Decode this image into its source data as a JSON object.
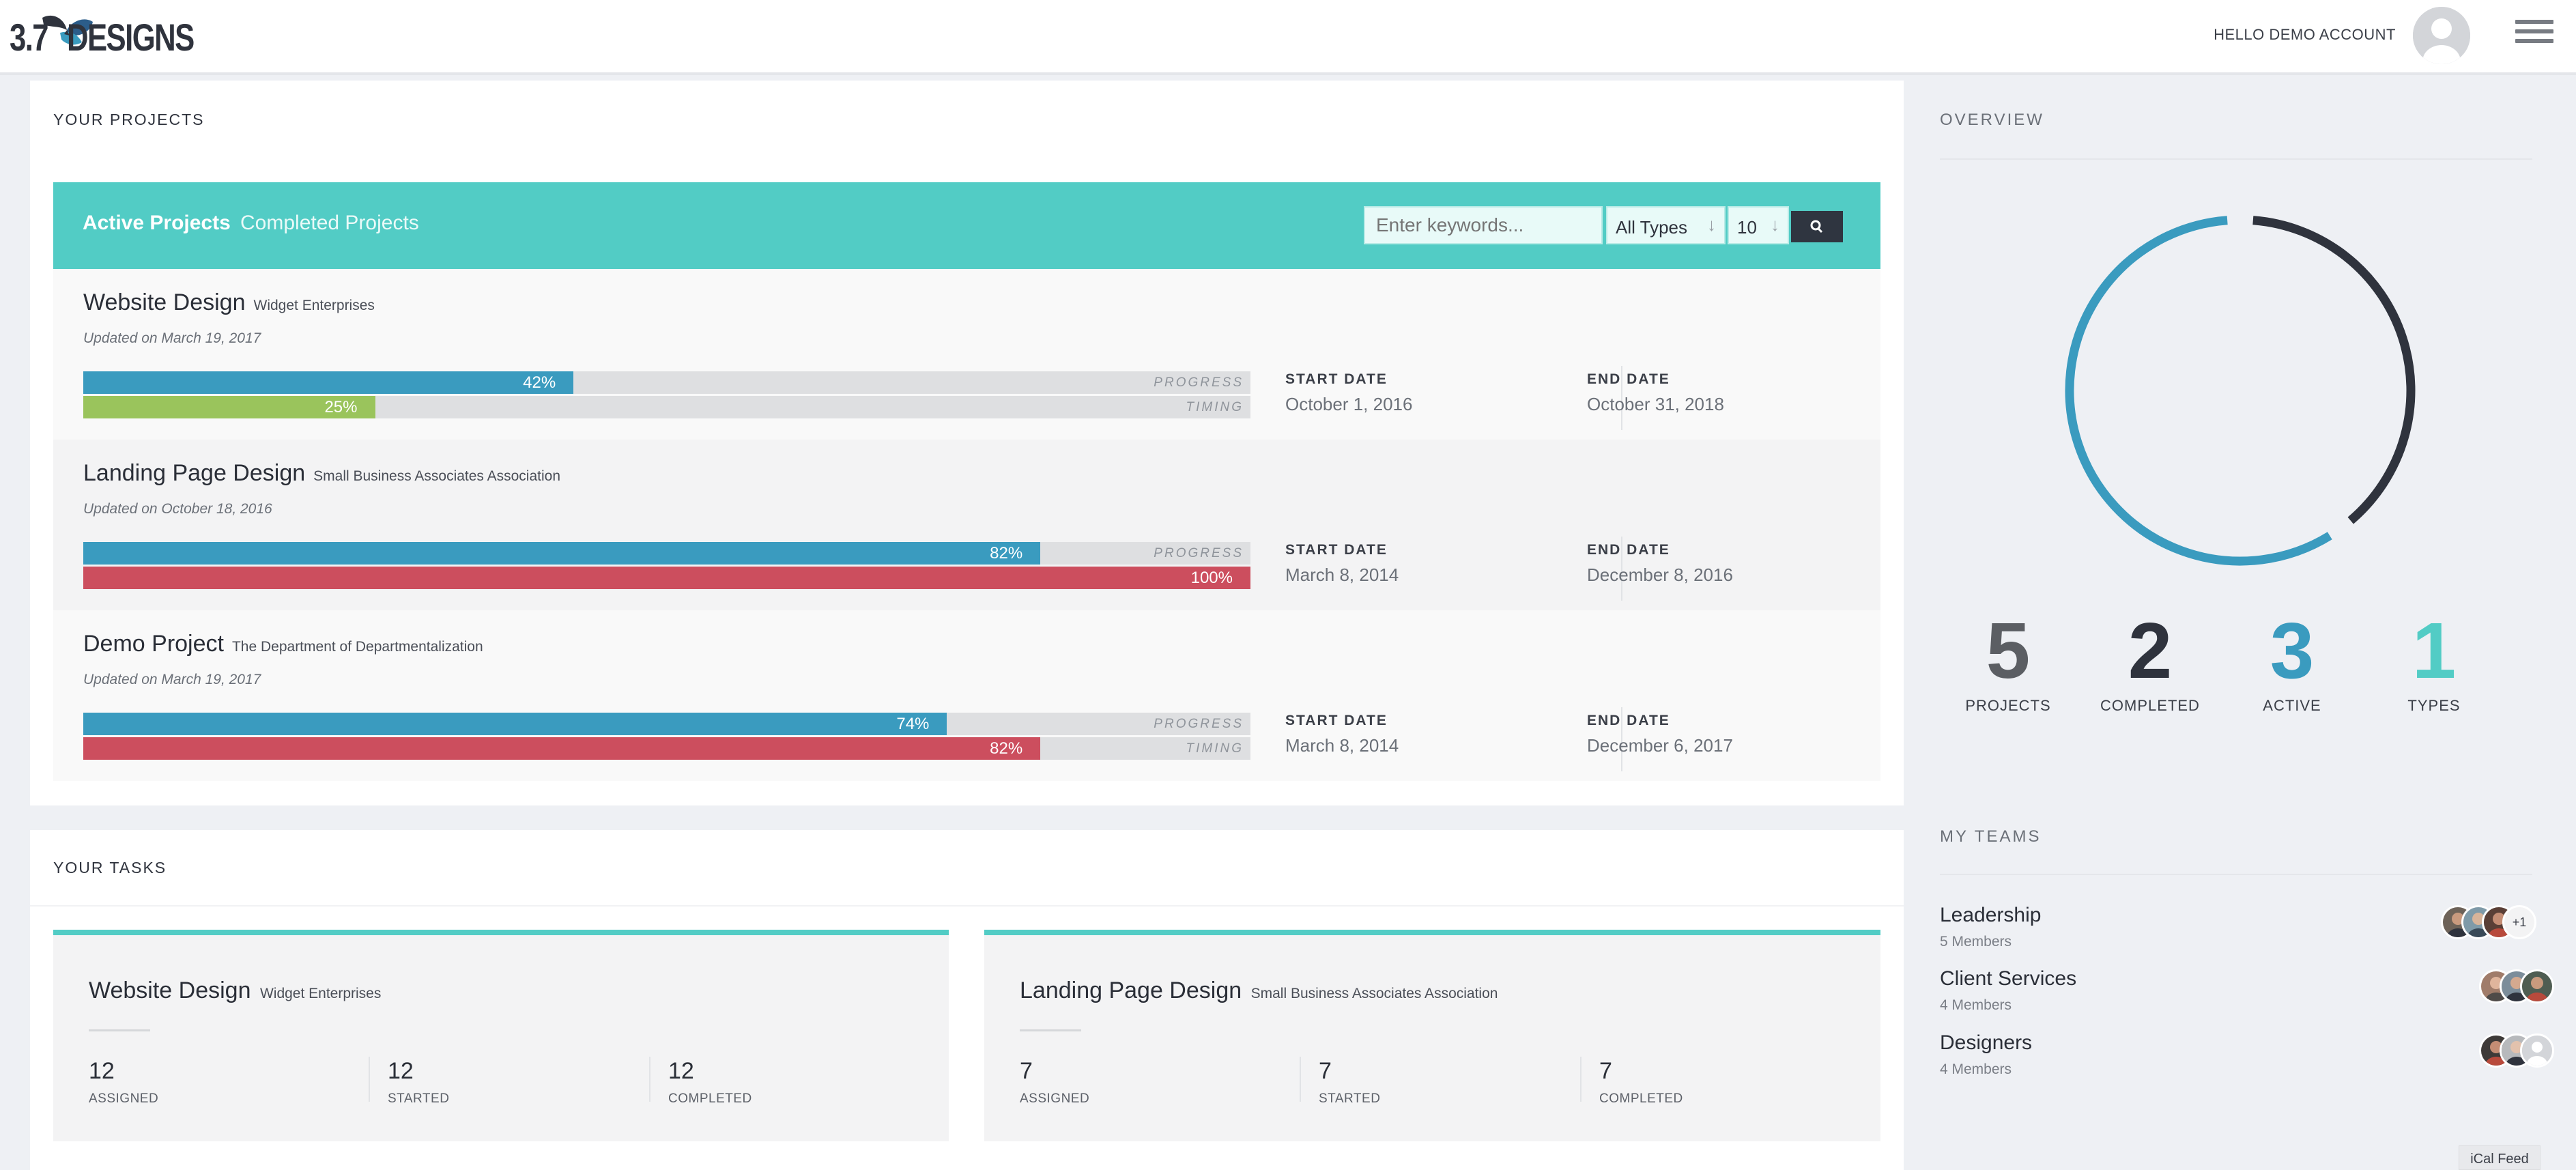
{
  "header": {
    "logo_number": "3.7",
    "logo_word": "DESIGNS",
    "greeting": "HELLO DEMO ACCOUNT"
  },
  "projects_panel": {
    "title": "YOUR PROJECTS",
    "tabs": [
      "Active Projects",
      "Completed Projects"
    ],
    "search_placeholder": "Enter keywords...",
    "type_filter": "All Types",
    "per_page": "10",
    "progress_label": "PROGRESS",
    "timing_label": "TIMING",
    "start_label": "START DATE",
    "end_label": "END DATE",
    "projects": [
      {
        "name": "Website Design",
        "client": "Widget Enterprises",
        "updated": "Updated on March 19, 2017",
        "progress": 42,
        "progress_text": "42%",
        "timing": 25,
        "timing_text": "25%",
        "timing_status": "on-track",
        "start": "October 1, 2016",
        "end": "October 31, 2018"
      },
      {
        "name": "Landing Page Design",
        "client": "Small Business Associates Association",
        "updated": "Updated on October 18, 2016",
        "progress": 82,
        "progress_text": "82%",
        "timing": 100,
        "timing_text": "100%",
        "timing_status": "overdue",
        "start": "March 8, 2014",
        "end": "December 8, 2016"
      },
      {
        "name": "Demo Project",
        "client": "The Department of Departmentalization",
        "updated": "Updated on March 19, 2017",
        "progress": 74,
        "progress_text": "74%",
        "timing": 82,
        "timing_text": "82%",
        "timing_status": "overdue",
        "start": "March 8, 2014",
        "end": "December 6, 2017"
      }
    ]
  },
  "tasks_panel": {
    "title": "YOUR TASKS",
    "cards": [
      {
        "name": "Website Design",
        "client": "Widget Enterprises",
        "stats": [
          {
            "value": "12",
            "label": "ASSIGNED"
          },
          {
            "value": "12",
            "label": "STARTED"
          },
          {
            "value": "12",
            "label": "COMPLETED"
          }
        ]
      },
      {
        "name": "Landing Page Design",
        "client": "Small Business Associates Association",
        "stats": [
          {
            "value": "7",
            "label": "ASSIGNED"
          },
          {
            "value": "7",
            "label": "STARTED"
          },
          {
            "value": "7",
            "label": "COMPLETED"
          }
        ]
      }
    ]
  },
  "overview": {
    "title": "OVERVIEW",
    "donut": {
      "completed": 2,
      "active": 3
    },
    "stats": [
      {
        "value": "5",
        "label": "PROJECTS",
        "color": "#5b5e63"
      },
      {
        "value": "2",
        "label": "COMPLETED",
        "color": "#2f333d"
      },
      {
        "value": "3",
        "label": "ACTIVE",
        "color": "#3a9bbf"
      },
      {
        "value": "1",
        "label": "TYPES",
        "color": "#52ccc5"
      }
    ]
  },
  "teams": {
    "title": "MY TEAMS",
    "items": [
      {
        "name": "Leadership",
        "members": "5 Members",
        "extra": "+1"
      },
      {
        "name": "Client Services",
        "members": "4 Members"
      },
      {
        "name": "Designers",
        "members": "4 Members"
      }
    ],
    "ical_label": "iCal Feed"
  },
  "colors": {
    "accent": "#52ccc5",
    "progress": "#3a9bbf",
    "on_track": "#9ac45c",
    "overdue": "#cc4e5e",
    "dark": "#2f333d"
  }
}
